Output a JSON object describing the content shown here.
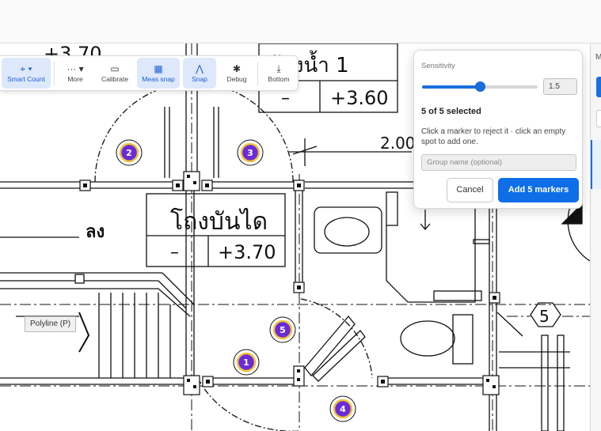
{
  "toolbar": {
    "items": [
      {
        "label": "Smart Count",
        "icon": "smart-count-icon"
      },
      {
        "label": "More",
        "icon": "more-icon"
      },
      {
        "label": "Calibrate",
        "icon": "ruler-icon"
      },
      {
        "label": "Meas snap",
        "icon": "grid-icon"
      },
      {
        "label": "Snap",
        "icon": "snap-icon"
      },
      {
        "label": "Debug",
        "icon": "bug-icon"
      },
      {
        "label": "Bottom",
        "icon": "download-icon"
      }
    ]
  },
  "popover": {
    "title": "Sensitivity",
    "sensitivity_value": "1.5",
    "slider_fraction": 0.5,
    "selected_text": "5 of 5 selected",
    "help_text": "Click a marker to reject it · click an empty spot to add one.",
    "group_placeholder": "Group name (optional)",
    "cancel_label": "Cancel",
    "add_label": "Add 5 markers"
  },
  "tooltip": "Polyline (P)",
  "drawing": {
    "stair_room_name": "โถงบันได",
    "stair_room_level": "+3.70",
    "stair_room_dash": "–",
    "bath_room_name_partial": "ห้องน้ำ 1",
    "bath_room_level": "+3.60",
    "bath_room_dash": "–",
    "top_left_level": "+3.70",
    "dimension_text": "2.00",
    "down_label": "ลง",
    "grid_bubble": "5"
  },
  "markers": [
    {
      "number": "2"
    },
    {
      "number": "3"
    },
    {
      "number": "5"
    },
    {
      "number": "1"
    },
    {
      "number": "4"
    }
  ],
  "right_panel": {
    "label": "M"
  },
  "colors": {
    "accent": "#1a6fe0",
    "marker_fill": "#6a2bd9",
    "marker_ring": "#f0c23a"
  }
}
